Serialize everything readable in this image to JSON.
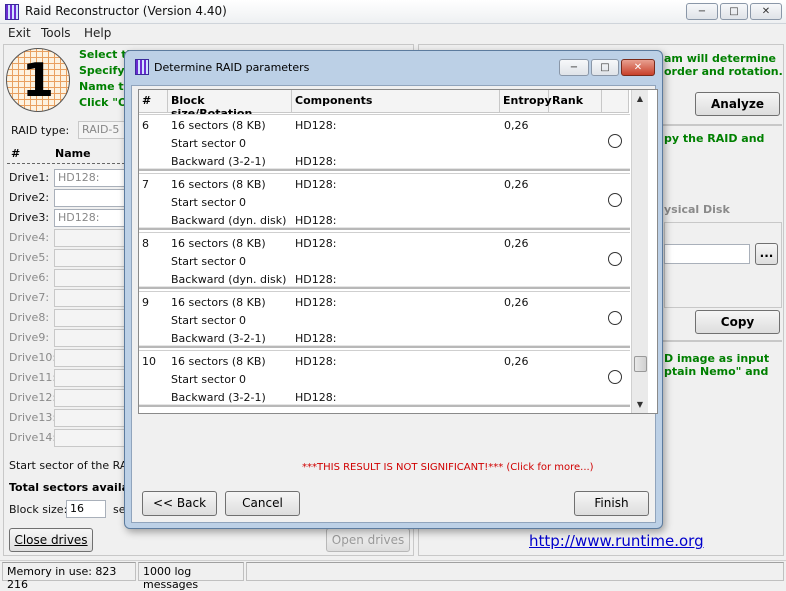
{
  "window": {
    "title": "Raid Reconstructor (Version 4.40)",
    "minimize_glyph": "−",
    "maximize_glyph": "□",
    "close_glyph": "✕"
  },
  "menu": {
    "items": [
      "Exit",
      "Tools",
      "Help"
    ]
  },
  "step1": {
    "number": "1",
    "lines": [
      "Select th",
      "Specify",
      "Name th",
      "Click \"O"
    ]
  },
  "raid": {
    "type_label": "RAID type:",
    "type_value": "RAID-5"
  },
  "drives": {
    "header_hash": "#",
    "header_name": "Name",
    "rows": [
      {
        "label": "Drive1:",
        "value": "HD128:",
        "enabled": true
      },
      {
        "label": "Drive2:",
        "value": "",
        "enabled": true
      },
      {
        "label": "Drive3:",
        "value": "HD128:",
        "enabled": true
      },
      {
        "label": "Drive4:",
        "value": "",
        "enabled": false
      },
      {
        "label": "Drive5:",
        "value": "",
        "enabled": false
      },
      {
        "label": "Drive6:",
        "value": "",
        "enabled": false
      },
      {
        "label": "Drive7:",
        "value": "",
        "enabled": false
      },
      {
        "label": "Drive8:",
        "value": "",
        "enabled": false
      },
      {
        "label": "Drive9:",
        "value": "",
        "enabled": false
      },
      {
        "label": "Drive10:",
        "value": "",
        "enabled": false
      },
      {
        "label": "Drive11:",
        "value": "",
        "enabled": false
      },
      {
        "label": "Drive12:",
        "value": "",
        "enabled": false
      },
      {
        "label": "Drive13:",
        "value": "",
        "enabled": false
      },
      {
        "label": "Drive14:",
        "value": "",
        "enabled": false
      }
    ]
  },
  "start_sector_label": "Start sector of the RAID",
  "total_sectors_label": "Total sectors availal",
  "block_size": {
    "label": "Block size:",
    "value": "16",
    "unit": "se"
  },
  "close_drives_label": "Close drives",
  "open_drives_label": "Open drives",
  "right": {
    "text1_lines": [
      "am will determine",
      "order and rotation."
    ],
    "analyze_label": "Analyze",
    "text2": "py the RAID and",
    "physical_disk_label": "ysical Disk",
    "browse_label": "...",
    "copy_label": "Copy",
    "text3_lines": [
      "D image as input",
      "ptain Nemo\" and"
    ],
    "url": "http://www.runtime.org"
  },
  "status": {
    "memory": "Memory in use: 823 216",
    "log": "1000 log messages"
  },
  "dialog": {
    "title": "Determine RAID parameters",
    "columns": [
      "#",
      "Block size/Rotation",
      "Components",
      "Entropy",
      "Rank"
    ],
    "rows": [
      {
        "num": "6",
        "block": "16 sectors (8 KB)",
        "comp1": "HD128:",
        "entropy": "0,26",
        "start": "Start sector 0",
        "rotation": "Backward (3-2-1)",
        "comp2": "HD128:"
      },
      {
        "num": "7",
        "block": "16 sectors (8 KB)",
        "comp1": "HD128:",
        "entropy": "0,26",
        "start": "Start sector 0",
        "rotation": "Backward (dyn. disk)",
        "comp2": "HD128:"
      },
      {
        "num": "8",
        "block": "16 sectors (8 KB)",
        "comp1": "HD128:",
        "entropy": "0,26",
        "start": "Start sector 0",
        "rotation": "Backward (dyn. disk)",
        "comp2": "HD128:"
      },
      {
        "num": "9",
        "block": "16 sectors (8 KB)",
        "comp1": "HD128:",
        "entropy": "0,26",
        "start": "Start sector 0",
        "rotation": "Backward (3-2-1)",
        "comp2": "HD128:"
      },
      {
        "num": "10",
        "block": "16 sectors (8 KB)",
        "comp1": "HD128:",
        "entropy": "0,26",
        "start": "Start sector 0",
        "rotation": "Backward (3-2-1)",
        "comp2": "HD128:"
      }
    ],
    "notice": "***THIS RESULT IS NOT SIGNIFICANT!*** (Click for more...)",
    "back_label": "<< Back",
    "cancel_label": "Cancel",
    "finish_label": "Finish",
    "scroll_up_glyph": "▲",
    "scroll_down_glyph": "▼"
  }
}
